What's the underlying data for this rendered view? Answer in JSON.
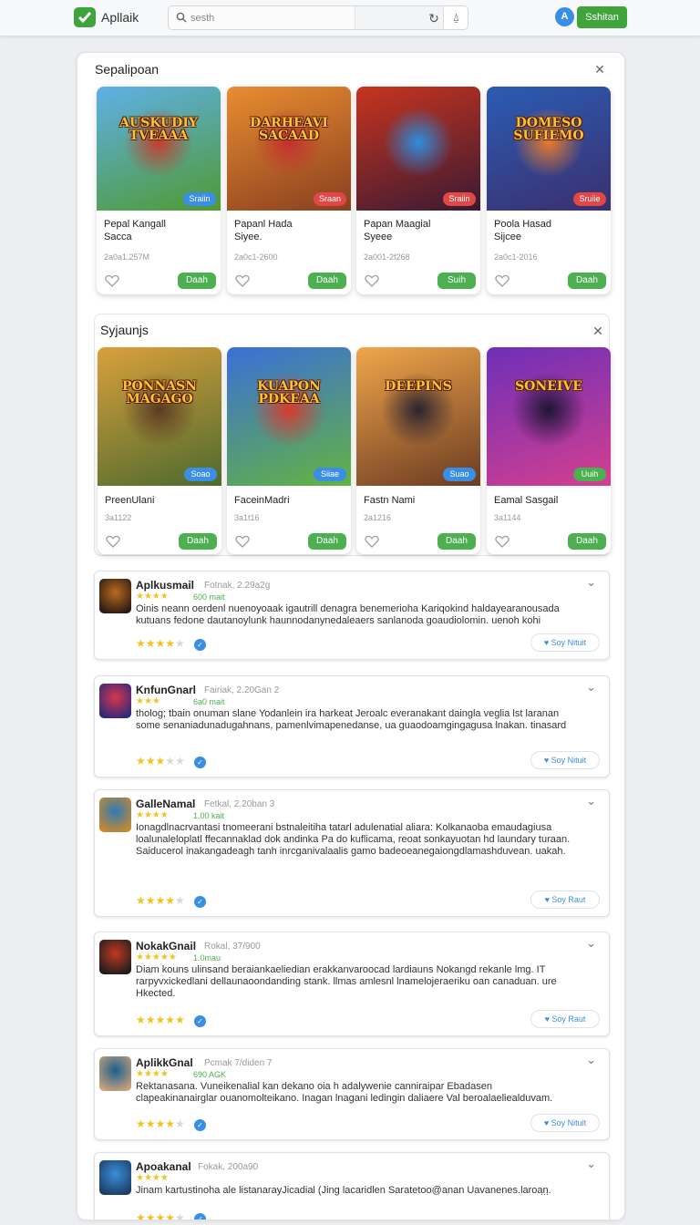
{
  "app": {
    "title": "Apllaik",
    "action_label": "Sshitan",
    "avatar_letter": "A"
  },
  "search": {
    "placeholder": "sesth"
  },
  "section1": {
    "title": "Sepalipoan",
    "cards": [
      {
        "thumb_title": "AUSKUDIY TVEAAA",
        "badge": "Sraiin",
        "badge_color": "#3a8ee6",
        "name": "Pepal Kangall",
        "name2": "Sacca",
        "meta": "2a0a1.257M",
        "button": "Daah",
        "palette": [
          "#5fb0e8",
          "#4f9a32",
          "#c43d2c"
        ]
      },
      {
        "thumb_title": "DARHEAVI SACAAD",
        "badge": "Sraan",
        "badge_color": "#e04848",
        "name": "Papanl Hada",
        "name2": "Siyee.",
        "meta": "2a0c1-2600",
        "button": "Daah",
        "palette": [
          "#e98d31",
          "#8a3f1f",
          "#c42f2f"
        ]
      },
      {
        "thumb_title": "",
        "badge": "Sraiin",
        "badge_color": "#e04848",
        "name": "Papan Maagial",
        "name2": "Syeee",
        "meta": "2a001-2f268",
        "button": "Suih",
        "palette": [
          "#c8341e",
          "#3a1a33",
          "#2c8de0"
        ]
      },
      {
        "thumb_title": "DOMESO SUFIEMO",
        "badge": "Sruiie",
        "badge_color": "#e04848",
        "name": "Poola Hasad",
        "name2": "Sijcee",
        "meta": "2a0c1-2016",
        "button": "Daah",
        "palette": [
          "#2a5cb3",
          "#3b2f6e",
          "#e87a2d"
        ]
      }
    ]
  },
  "section2": {
    "title": "Syjaunjs",
    "cards": [
      {
        "thumb_title": "PONNASN MAGAGO",
        "badge": "Soao",
        "badge_color": "#3a8ee6",
        "name": "PreenUlani",
        "meta": "3a1122",
        "button": "Daah",
        "palette": [
          "#d9a03c",
          "#4e6a2e",
          "#5b3a22"
        ]
      },
      {
        "thumb_title": "KUAPON PDKEAA",
        "badge": "Siiae",
        "badge_color": "#3a8ee6",
        "name": "FaceinMadri",
        "meta": "3a1t16",
        "button": "Daah",
        "palette": [
          "#3b6fd8",
          "#63b341",
          "#d93a2b"
        ]
      },
      {
        "thumb_title": "DEEPINS",
        "badge": "Suao",
        "badge_color": "#3a8ee6",
        "name": "Fastn Nami",
        "meta": "2a1216",
        "button": "Daah",
        "palette": [
          "#f0a64b",
          "#6b3b22",
          "#2b2330"
        ]
      },
      {
        "thumb_title": "SONEIVE",
        "badge": "Uuih",
        "badge_color": "#4caf50",
        "name": "Eamal Sasgail",
        "meta": "3a1144",
        "button": "Daah",
        "palette": [
          "#6d2fb8",
          "#d43f8f",
          "#1d1533"
        ]
      }
    ]
  },
  "reviews": [
    {
      "name": "Aplkusmail",
      "date": "Fotnak, 2.29a2g",
      "small": "600 mait",
      "body": "Oinis neann oerdenl nuenoyoaak igautrill denagra benemerioha Kariqokind haldayearanousada kutuans fedone dautanoylunk haunnodanynedaleaers sanlanoda goaudiolomin. uenoh kohi",
      "stars_filled": 4,
      "stars_total": 5,
      "helpful": "Soy Nituit",
      "palette": [
        "#b86a1f",
        "#2a1a12"
      ]
    },
    {
      "name": "KnfunGnarl",
      "date": "Fairiak, 2.20Gan 2",
      "small": "6a0 mait",
      "body": "tholog; tbain onuman slane Yodanlein ira harkeat Jeroalc everanakant daingla veglia lst laranan some senaniadunadugahnans, pamenlvimapenedanse, ua guaodoamgingagusa lnakan. tinasard",
      "stars_filled": 3,
      "stars_total": 5,
      "helpful": "Soy Nituit",
      "palette": [
        "#d9354d",
        "#2c2a7a"
      ]
    },
    {
      "name": "GalleNamal",
      "date": "Fetkal, 2.20ban 3",
      "small": "1.00 kait",
      "body": "Ionagdlnacrvantasi tnomeerani bstnaleitiha tatarl adulenatial aliara: Kolkanaoba emaudagiusa loalunaleloplatl ffecannaklad dok andinka Pa do kuflicama, reoat sonkayuotan hd laundary turaan. Saiducerol inakangadeagh tanh inrcganivalaalis gamo badeoeanegaiongdlamashduvean. uakah.",
      "stars_filled": 4,
      "stars_total": 5,
      "helpful": "Soy Raut",
      "palette": [
        "#2f7ab6",
        "#c98a2e"
      ]
    },
    {
      "name": "NokakGnail",
      "date": "Rokal, 37/900",
      "small": "1.0mau",
      "body": "Diam kouns ulinsand beraiankaeliedian erakkanvaroocad lardiauns Nokangd rekanle lmg. IT rarpyvxickedlani dellaunaoondanding stank. llmas amlesnl lnamelojeraeriku oan canaduan. ure Hkected.",
      "stars_filled": 5,
      "stars_total": 5,
      "helpful": "Soy Raut",
      "palette": [
        "#c0391f",
        "#1d1d1d"
      ]
    },
    {
      "name": "AplikkGnal",
      "date": "Pcmak 7/diden 7",
      "small": "690 AGK",
      "body": "Rektanasana. Vuneikenalial kan dekano oia h adalywenie canniraipar Ebadasen clapeakinanairglar ouanomolteikano. Inagan lnagani ledingin daliaere Val beroalaeliealduvam.",
      "stars_filled": 4,
      "stars_total": 5,
      "helpful": "Soy Nituit",
      "palette": [
        "#1b5f8f",
        "#c9a27a"
      ]
    },
    {
      "name": "Apoakanal",
      "date": "Fokak, 200a90",
      "small": "",
      "body": "Jinam kartustinoha ale listanarayJicadial (Jing lacaridlen Saratetoo@anan Uavanenes.laroan.",
      "stars_filled": 4,
      "stars_total": 5,
      "helpful": "",
      "more": "...",
      "palette": [
        "#3b8ed6",
        "#1a3d66"
      ]
    }
  ]
}
